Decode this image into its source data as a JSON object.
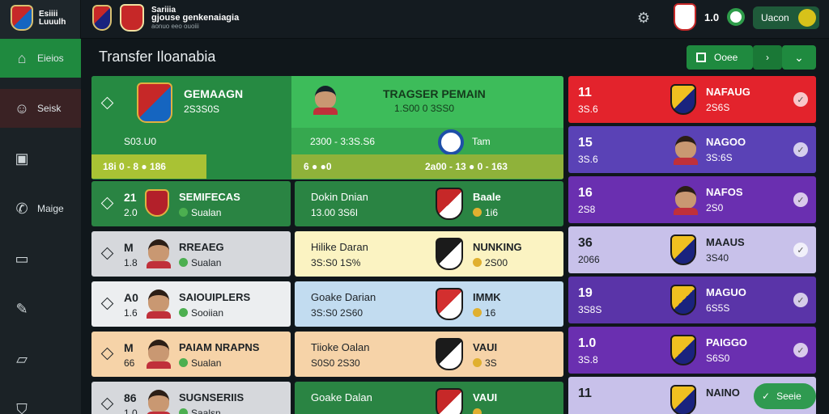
{
  "app": {
    "brand_lines": [
      "Esiiii",
      "Luuulh"
    ],
    "club_name": "Sariiia",
    "club_subtitle": "gjouse genkenaiagia",
    "club_caption": "aonuo eeo ouoiii",
    "balance": "1.0",
    "account_label": "Uacon",
    "settings_icon": "gear-icon"
  },
  "sidebar": {
    "items": [
      {
        "label": "Eieios",
        "icon": "home-icon",
        "active": true
      },
      {
        "label": "Seisk",
        "icon": "portrait-icon",
        "active": false
      },
      {
        "label": "",
        "icon": "squad-icon",
        "active": false
      },
      {
        "label": "Maige",
        "icon": "phone-icon",
        "active": false
      },
      {
        "label": "",
        "icon": "window-icon",
        "active": false
      },
      {
        "label": "",
        "icon": "edit-icon",
        "active": false
      },
      {
        "label": "",
        "icon": "map-icon",
        "active": false
      },
      {
        "label": "",
        "icon": "shield-icon",
        "active": false
      }
    ]
  },
  "page": {
    "title": "Transfer Iloanabia",
    "control_label": "Ooee"
  },
  "feature": {
    "left_name": "GEMAAGN",
    "left_sub": "2S3S0S",
    "left_stats": "S03.U0",
    "left_bar": "18i  0  - 8  ● 186",
    "center_title": "TRAGSER PEMAIN",
    "center_line": "1.S00  0  3SS0",
    "center_mid_left": "2300 - 3:3S.S6",
    "center_mid_right": "Tam",
    "center_bar_left": "6   ●   ●0",
    "center_bar_right": "2a00 - 13 ● 0 - 163"
  },
  "left_list": [
    {
      "num": "21",
      "sub": "2.0",
      "name": "SEMIFECAS",
      "club": "Sualan",
      "theme": "green"
    },
    {
      "num": "M",
      "sub": "1.8",
      "name": "RREAEG",
      "club": "Sualan",
      "theme": "grey"
    },
    {
      "num": "A0",
      "sub": "1.6",
      "name": "SAIOUIPLERS",
      "club": "Sooiian",
      "theme": "white"
    },
    {
      "num": "M",
      "sub": "66",
      "name": "PAIAM NRAPNS",
      "club": "Sualan",
      "theme": "peach"
    },
    {
      "num": "86",
      "sub": "1.0",
      "name": "SUGNSERIIS",
      "club": "Saalsn",
      "theme": "grey"
    }
  ],
  "mid_list": [
    {
      "line1": "Dokin Dnian",
      "line2": "13.00  3S6I",
      "name": "Baale",
      "value": "1i6",
      "theme": "green"
    },
    {
      "line1": "Hilike Daran",
      "line2": "3S:S0  1S%",
      "name": "NUNKING",
      "value": "2S00",
      "theme": "yellow"
    },
    {
      "line1": "Goake Darian",
      "line2": "3S:S0  2S60",
      "name": "IMMK",
      "value": "16",
      "theme": "blue"
    },
    {
      "line1": "Tiioke Oalan",
      "line2": "S0S0  2S30",
      "name": "VAUI",
      "value": "3S",
      "theme": "peach"
    },
    {
      "line1": "Goake Dalan",
      "line2": "",
      "name": "VAUI",
      "value": "",
      "theme": "green"
    }
  ],
  "right_list": [
    {
      "num": "11",
      "sub": "3S.6",
      "name": "NAFAUG",
      "value": "2S6S",
      "theme": "red"
    },
    {
      "num": "15",
      "sub": "3S.6",
      "name": "NAGOO",
      "value": "3S:6S",
      "theme": "indigo"
    },
    {
      "num": "16",
      "sub": "2S8",
      "name": "NAFOS",
      "value": "2S0",
      "theme": "violet"
    },
    {
      "num": "36",
      "sub": "2066",
      "name": "MAAUS",
      "value": "3S40",
      "theme": "lavender"
    },
    {
      "num": "19",
      "sub": "3S8S",
      "name": "MAGUO",
      "value": "6S5S",
      "theme": "purple"
    },
    {
      "num": "1.0",
      "sub": "3S.8",
      "name": "PAIGGO",
      "value": "S6S0",
      "theme": "violet"
    },
    {
      "num": "11",
      "sub": "",
      "name": "NAINO",
      "value": "",
      "theme": "lavender"
    }
  ],
  "fab": {
    "label": "Seeie"
  },
  "colors": {
    "accent_green": "#1f8a3f",
    "header_bg": "#141b20",
    "sidebar_bg": "#1b2226"
  }
}
